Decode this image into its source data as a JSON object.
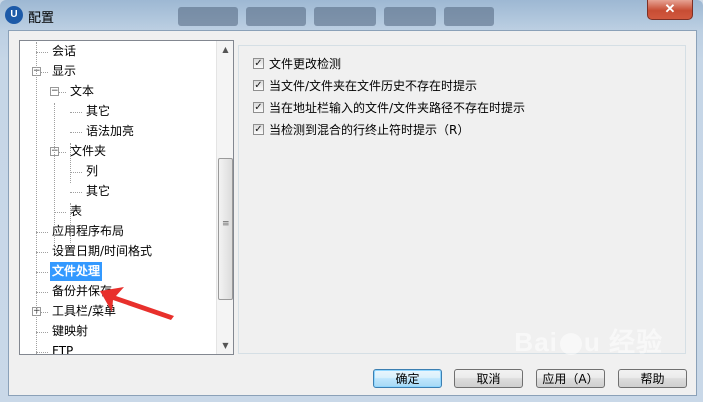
{
  "window": {
    "title": "配置",
    "app_icon": "app-logo-icon"
  },
  "title_tabs": [
    "",
    "",
    "",
    "",
    ""
  ],
  "tree": {
    "items": [
      {
        "label": "会话",
        "level": 0,
        "expander": ""
      },
      {
        "label": "显示",
        "level": 0,
        "expander": "−"
      },
      {
        "label": "文本",
        "level": 1,
        "expander": "−"
      },
      {
        "label": "其它",
        "level": 2,
        "expander": ""
      },
      {
        "label": "语法加亮",
        "level": 2,
        "expander": ""
      },
      {
        "label": "文件夹",
        "level": 1,
        "expander": "−"
      },
      {
        "label": "列",
        "level": 2,
        "expander": ""
      },
      {
        "label": "其它",
        "level": 2,
        "expander": ""
      },
      {
        "label": "表",
        "level": 1,
        "expander": ""
      },
      {
        "label": "应用程序布局",
        "level": 0,
        "expander": ""
      },
      {
        "label": "设置日期/时间格式",
        "level": 0,
        "expander": ""
      },
      {
        "label": "文件处理",
        "level": 0,
        "expander": "",
        "selected": true
      },
      {
        "label": "备份并保存",
        "level": 0,
        "expander": ""
      },
      {
        "label": "工具栏/菜单",
        "level": 0,
        "expander": "+"
      },
      {
        "label": "键映射",
        "level": 0,
        "expander": ""
      },
      {
        "label": "FTP",
        "level": 0,
        "expander": ""
      }
    ],
    "scroll_up": "▲",
    "scroll_down": "▼",
    "thumb_grip": "≡"
  },
  "options": [
    {
      "label": "文件更改检测",
      "checked": true
    },
    {
      "label": "当文件/文件夹在文件历史不存在时提示",
      "checked": true
    },
    {
      "label": "当在地址栏输入的文件/文件夹路径不存在时提示",
      "checked": true
    },
    {
      "label": "当检测到混合的行终止符时提示（R）",
      "checked": true
    }
  ],
  "buttons": {
    "ok": "确定",
    "cancel": "取消",
    "apply": "应用（A）",
    "help": "帮助"
  },
  "close_glyph": "✕",
  "watermark": "Baidu 经验",
  "colors": {
    "selection": "#3399ff",
    "annotation_arrow": "#e8302c",
    "close_button": "#c74d34"
  }
}
